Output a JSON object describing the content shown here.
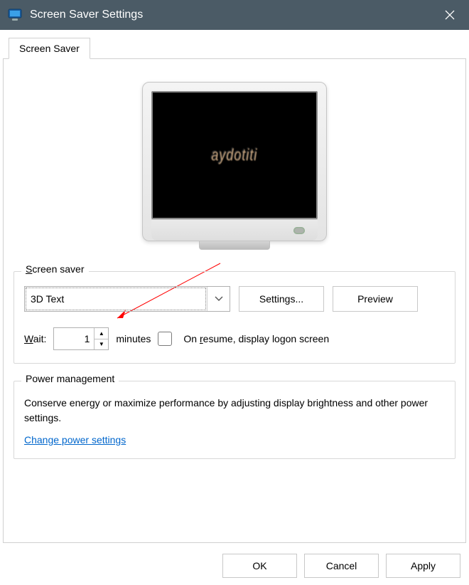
{
  "window": {
    "title": "Screen Saver Settings"
  },
  "tabs": {
    "main": "Screen Saver"
  },
  "preview": {
    "text3d": "aydotiti"
  },
  "screensaver_group": {
    "legend": "Screen saver",
    "dropdown_value": "3D Text",
    "settings_btn": "Settings...",
    "preview_btn": "Preview",
    "wait_label": "Wait:",
    "wait_value": "1",
    "minutes_label": "minutes",
    "resume_label": "On resume, display logon screen"
  },
  "power_group": {
    "legend": "Power management",
    "desc": "Conserve energy or maximize performance by adjusting display brightness and other power settings.",
    "link": "Change power settings"
  },
  "buttons": {
    "ok": "OK",
    "cancel": "Cancel",
    "apply": "Apply"
  }
}
